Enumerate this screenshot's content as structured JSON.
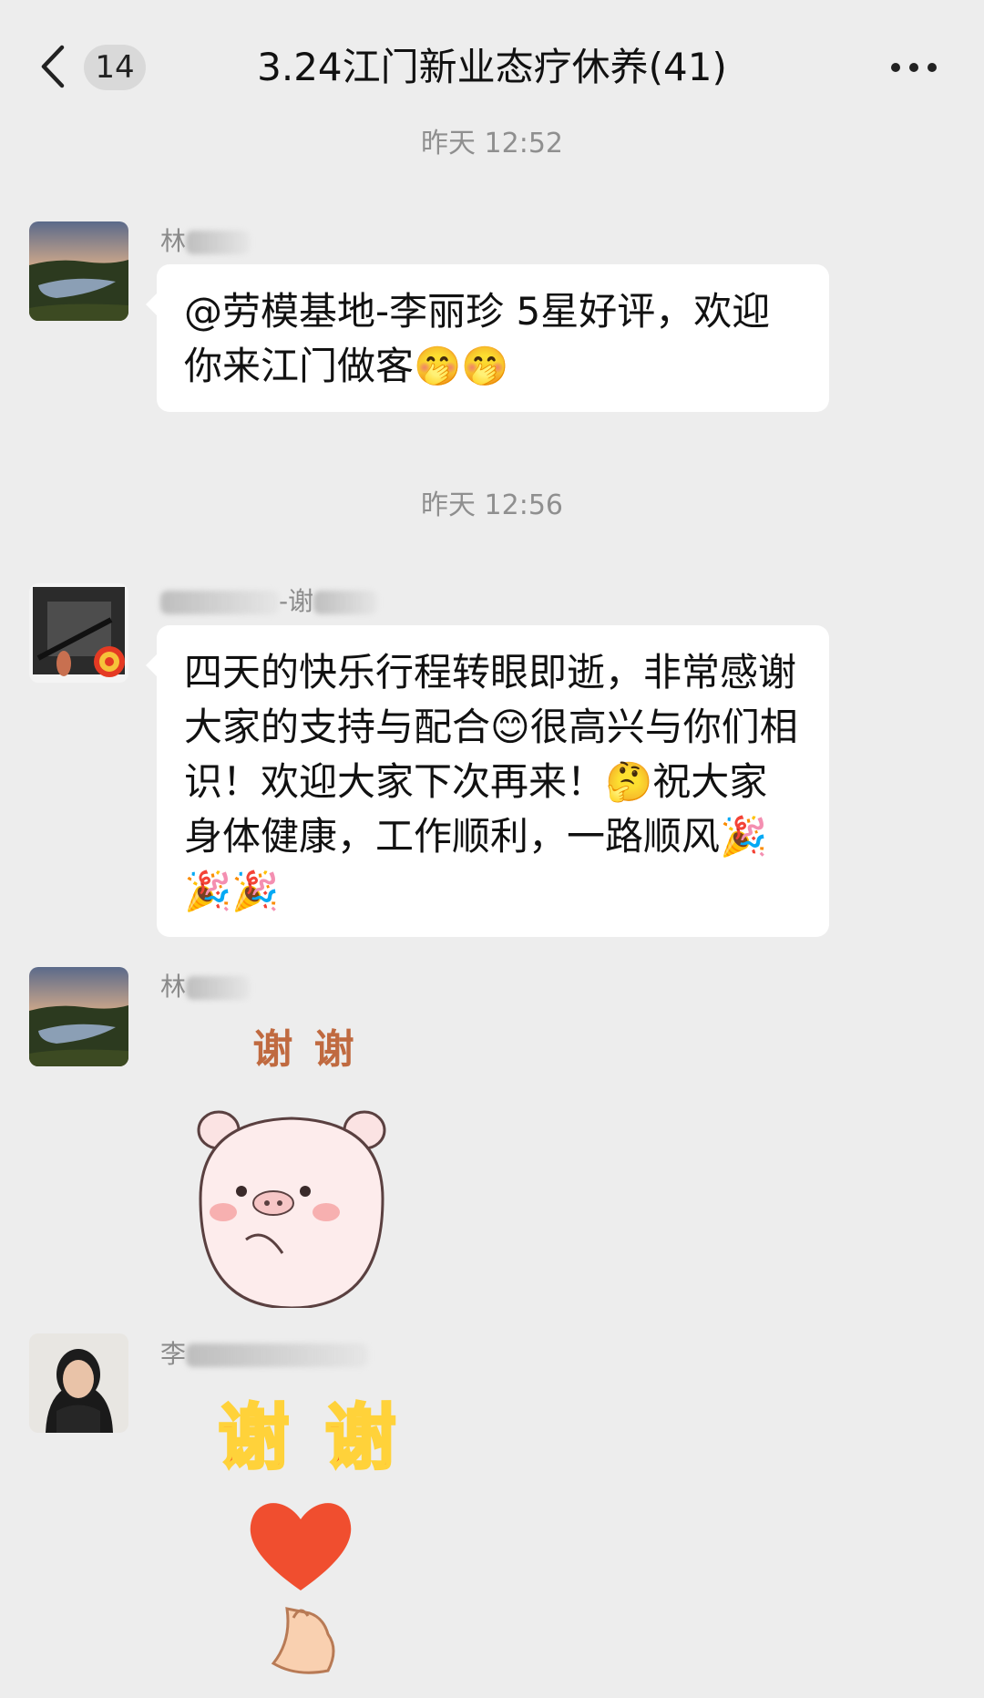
{
  "header": {
    "back_icon": "chevron-left-icon",
    "unread_count": "14",
    "title": "3.24江门新业态疗休养(41)",
    "more_icon": "more-dots-icon"
  },
  "messages": {
    "time1": "昨天 12:52",
    "msg1": {
      "sender": "林",
      "text": "@劳模基地-李丽珍 5星好评，欢迎你来江门做客🤭🤭"
    },
    "time2": "昨天 12:56",
    "msg2": {
      "sender": "-谢",
      "text": "四天的快乐行程转眼即逝，非常感谢大家的支持与配合😊很高兴与你们相识！欢迎大家下次再来！🤔祝大家身体健康，工作顺利，一路顺风🎉🎉🎉"
    },
    "msg3": {
      "sender": "林",
      "sticker_text": "谢 谢"
    },
    "msg4": {
      "sender": "李",
      "sticker_text": "谢 谢"
    }
  },
  "colors": {
    "background": "#ededed",
    "bubble": "#ffffff",
    "sticker_red": "#f23a1c",
    "sticker_yellow": "#ffd23a"
  }
}
